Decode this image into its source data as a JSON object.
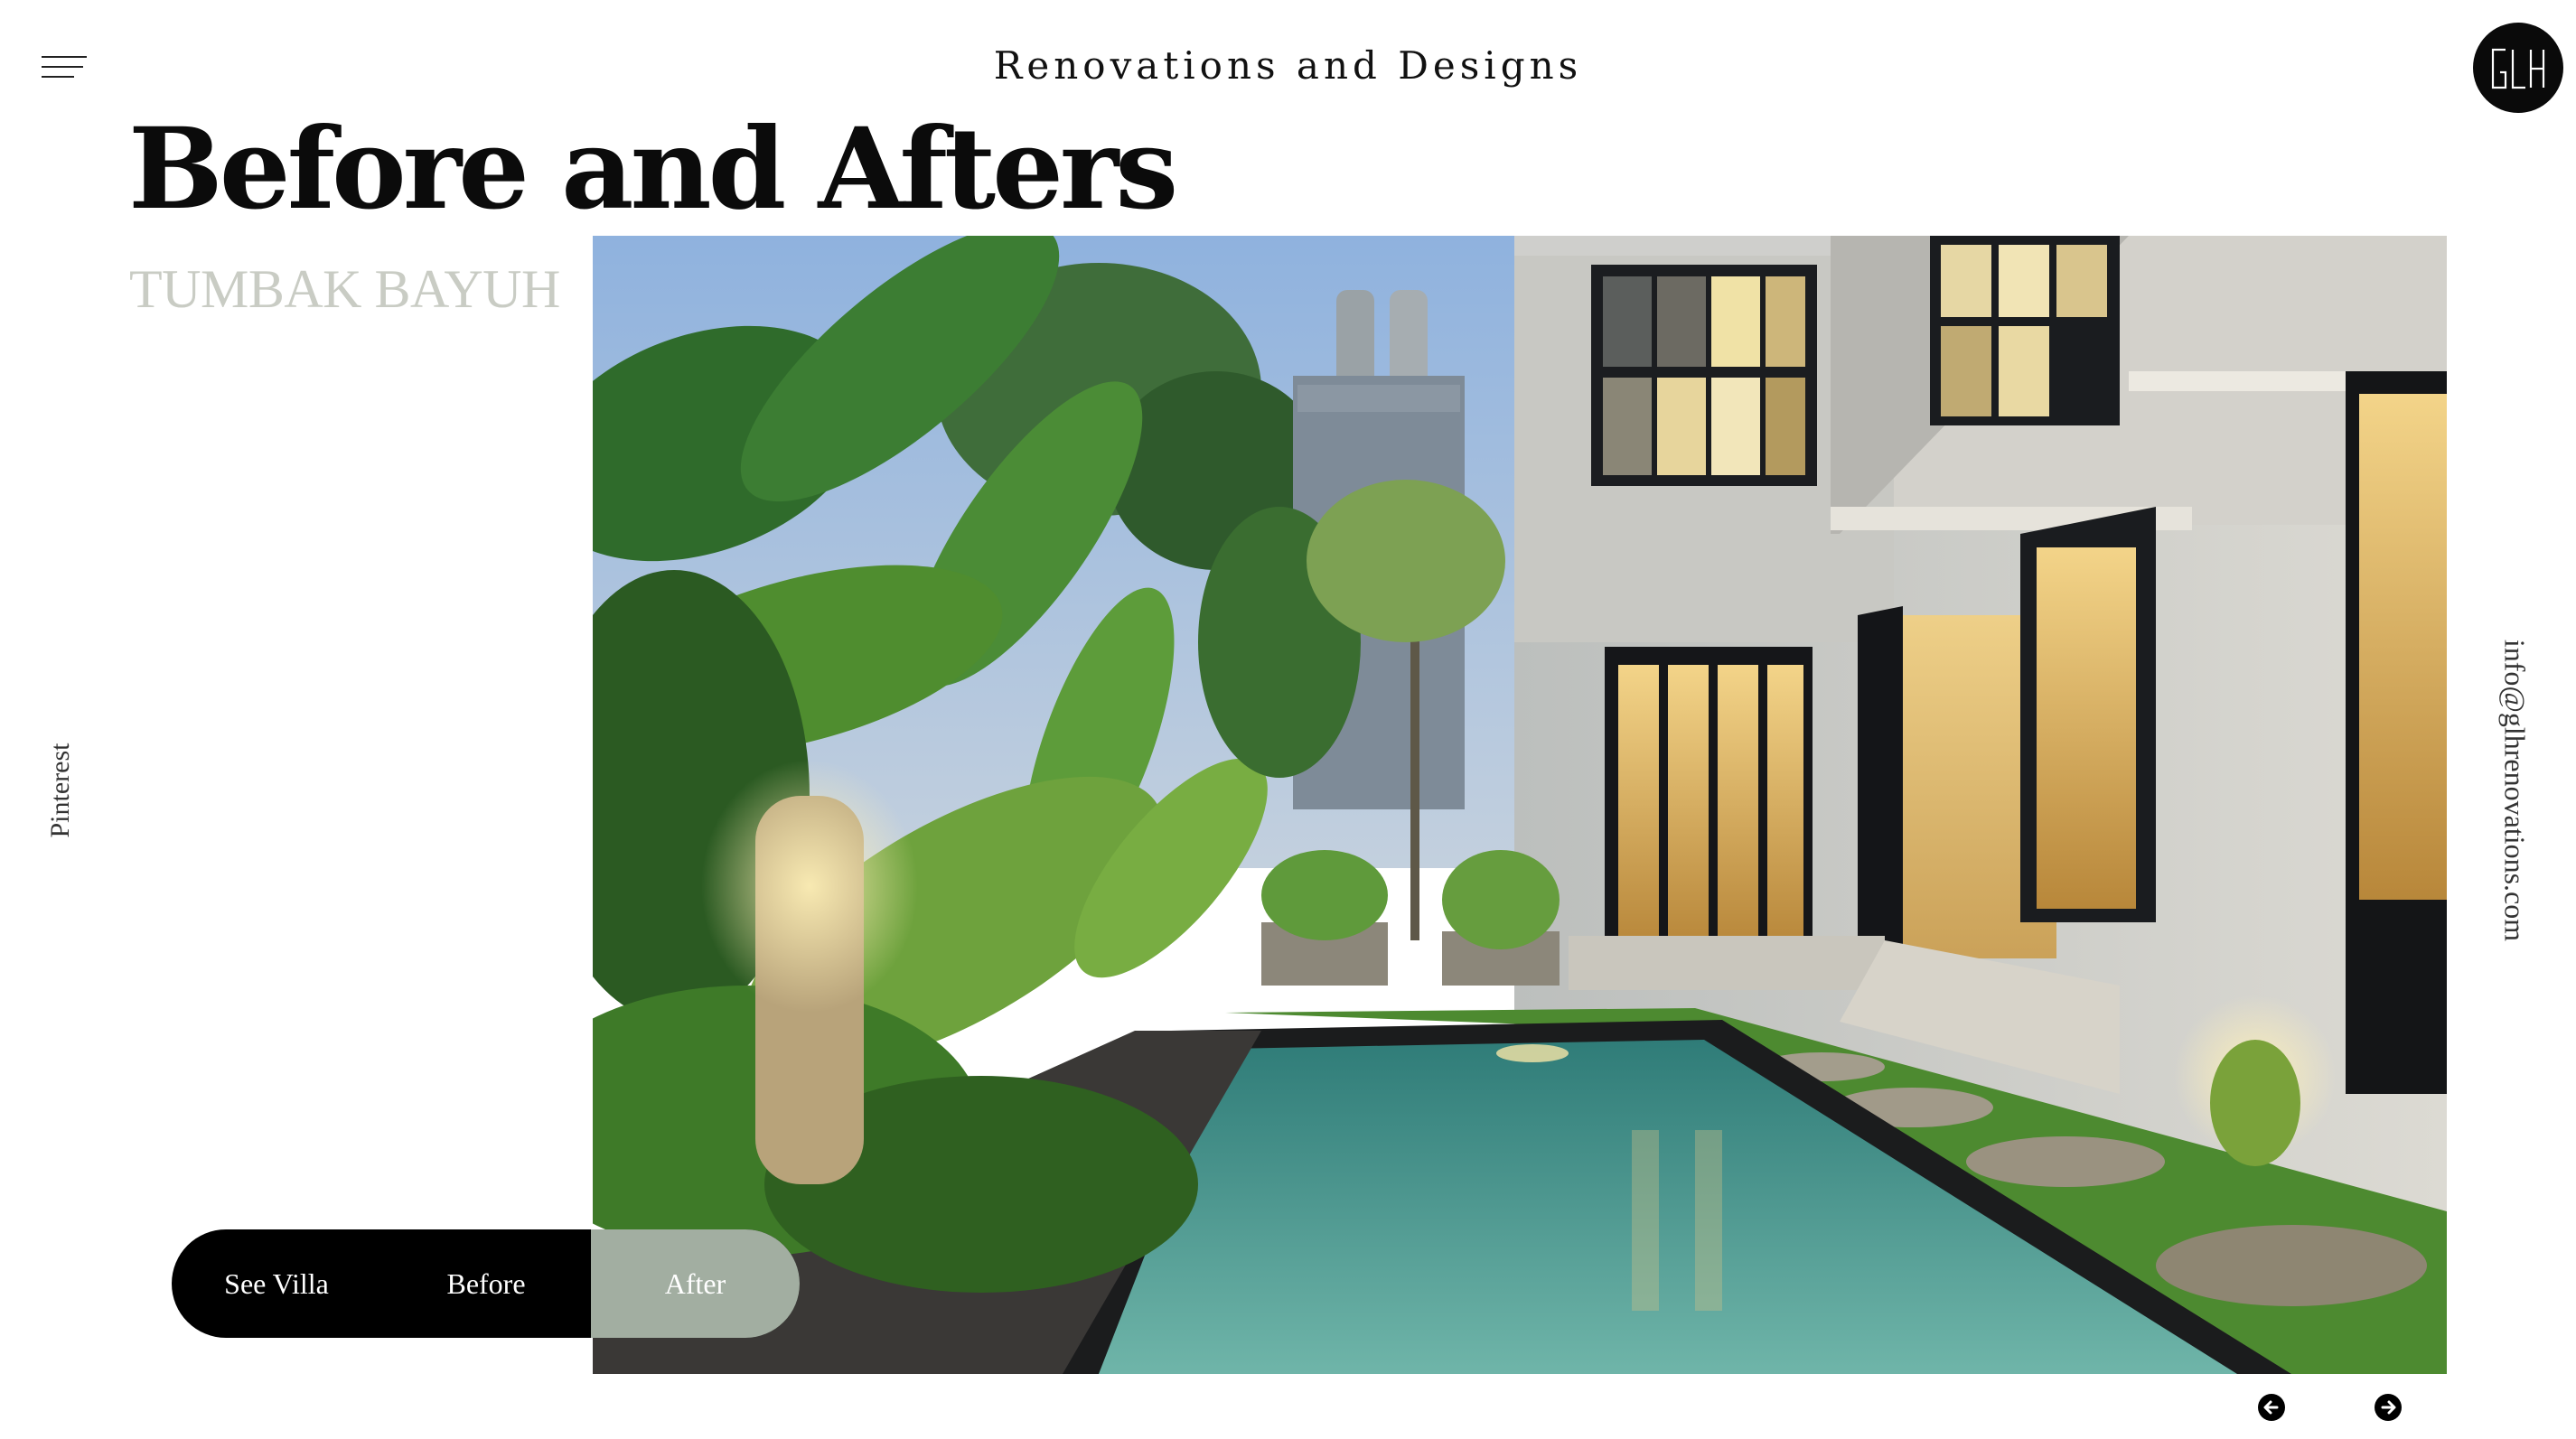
{
  "header": {
    "site_title": "Renovations and Designs",
    "menu_icon": "hamburger-menu-icon",
    "logo_text": "GLH"
  },
  "main": {
    "title": "Before and Afters",
    "villa_name": "TUMBAK BAYUH"
  },
  "side": {
    "left_link": "Pinterest",
    "right_link": "info@glhrenovations.com"
  },
  "controls": {
    "see_villa_label": "See Villa",
    "before_label": "Before",
    "after_label": "After",
    "active": "After"
  },
  "pager": {
    "prev_icon": "arrow-left-circle-icon",
    "next_icon": "arrow-right-circle-icon"
  },
  "colors": {
    "background": "#ffffff",
    "text": "#111111",
    "subtitle": "#c9ccc4",
    "pill": "#000000",
    "pill_active": "#a2aea1"
  }
}
